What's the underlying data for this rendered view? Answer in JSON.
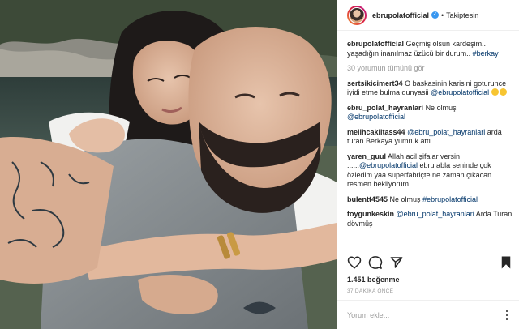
{
  "post": {
    "image_alt": "Bearded tattooed man hugged from behind by a dark-haired woman on a boat",
    "icons": [
      "heart-icon",
      "comment-icon",
      "share-icon",
      "bookmark-icon",
      "verified-badge-icon",
      "options-icon"
    ]
  },
  "header": {
    "username": "ebrupolatofficial",
    "verified_mark": "✓",
    "separator": "•",
    "follow_status": "Takiptesin"
  },
  "caption": {
    "username": "ebrupolatofficial",
    "text": "Geçmiş olsun kardeşim.. yaşadığın inanılmaz üzücü bir durum..",
    "hashtag": "#berkay"
  },
  "view_all_comments": "30 yorumun tümünü gör",
  "comments": [
    {
      "username": "sertsikicimert34",
      "text": "O baskasinin karisini goturunce iyidi etme bulma dunyasii",
      "mention": "@ebrupolatofficial"
    },
    {
      "username": "ebru_polat_hayranlari",
      "text": "Ne olmuş",
      "mention": "@ebrupolatofficial"
    },
    {
      "username": "melihcakiltass44",
      "mention": "@ebru_polat_hayranlari",
      "text": "arda turan Berkaya yumruk attı"
    },
    {
      "username": "yaren_guul",
      "text_before": "Allah acil şifalar versin ......",
      "mention": "@ebrupolatofficial",
      "text_after": "ebru abla seninde çok özledim yaa superfabriçte ne zaman çıkacan resmen bekliyorum ..."
    },
    {
      "username": "bulentt4545",
      "text": "Ne olmuş",
      "mention": "#ebrupolatofficial"
    },
    {
      "username": "toygunkeskin",
      "mention": "@ebru_polat_hayranlari",
      "text": "Arda Turan dövmüş"
    }
  ],
  "likes": "1.451 beğenme",
  "time_ago": "37 DAKİKA ÖNCE",
  "comment_input": {
    "placeholder": "Yorum ekle...",
    "value": ""
  }
}
